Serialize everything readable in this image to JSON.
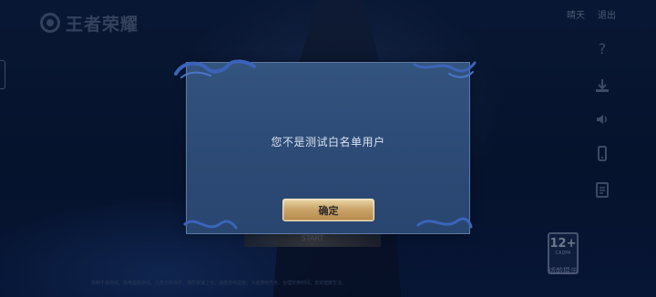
{
  "app": {
    "logo_text": "王者荣耀"
  },
  "top_bar": {
    "links": [
      "晴天",
      "退出"
    ]
  },
  "background": {
    "start_label": "START",
    "footer_text": "抵制不良游戏，拒绝盗版游戏。注意自我保护，谨防受骗上当。适度游戏益脑，沉迷游戏伤身。合理安排时间，享受健康生活。"
  },
  "side_icons": [
    "help-icon",
    "download-icon",
    "volume-icon",
    "phone-icon",
    "notice-icon"
  ],
  "age_rating": {
    "number": "12+",
    "sub": "CADPA",
    "label": "适龄提示"
  },
  "dialog": {
    "message": "您不是测试白名单用户",
    "confirm_label": "确定"
  },
  "colors": {
    "dialog_bg": "#2f4f7a",
    "button_gold": "#caa56a",
    "accent_blue": "#3b64b8"
  }
}
